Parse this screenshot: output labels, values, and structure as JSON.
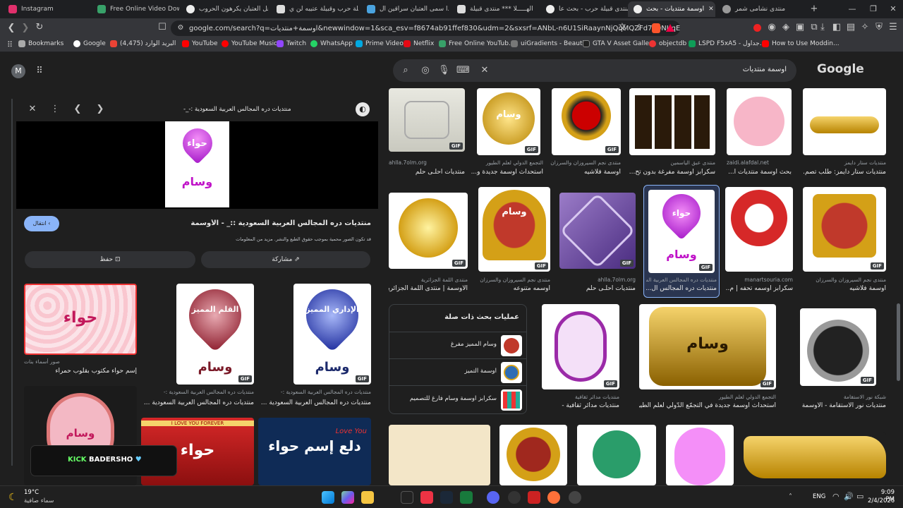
{
  "tabs": [
    {
      "title": "Instagram",
      "color": "#e1306c"
    },
    {
      "title": "Free Online Video Downlo",
      "color": "#38a169"
    },
    {
      "title": "هل العتبان يكرهون الحروب",
      "color": "#eee"
    },
    {
      "title": "قبيلة حرب وقبيلة عتيبه لن ي",
      "color": "#eee"
    },
    {
      "title": "لماذا سمى العتبان سراقين ال",
      "color": "#4aa3df"
    },
    {
      "title": "الهـــــلا *** منتدى قبيلة",
      "color": "#eee"
    },
    {
      "title": "منتدى قبيلة حرب - بحث عا",
      "color": "#eee"
    },
    {
      "title": "اوسمة منتديات - بحث",
      "color": "#eee",
      "active": true
    },
    {
      "title": "منتدى نشامى شمر",
      "color": "#eee"
    }
  ],
  "url": "google.com/search?q=اوسمة+منتديات&newwindow=1&sca_esv=f8674ab91ffef830&udm=2&sxsrf=ANbL-n6U1SiRaaynNjQqMQZFd7g0NJrqEQ...",
  "bookmarks": [
    "Bookmarks",
    "Google",
    "(4,475) البريد الوارد",
    "YouTube",
    "YouTube Music",
    "Twitch",
    "WhatsApp",
    "Prime Video",
    "Netflix",
    "Free Online YouTub...",
    "uiGradients - Beauti...",
    "GTA V Asset Gallery",
    "objectdb",
    "LSPD F5xA5 - جداول...",
    "How to Use Moddin..."
  ],
  "avatar": "M",
  "search": {
    "query": "اوسمة منتديات",
    "logo": "Google"
  },
  "preview": {
    "site": "منتديات دره المجالس العربية السعودية :-_-",
    "title": "منتديات دره المجالس العربية السعودية ::_ - الأوسمة",
    "notice": "قد تكون الصور محمية بموجب حقوق الطبع والنشر. مزيد من المعلومات",
    "visit": "انتقال",
    "save": "حفظ",
    "share": "مشاركة",
    "image_text": "حواء",
    "image_text2": "وسام"
  },
  "related_left": [
    {
      "cap": "إسم حواء مكتوب بقلوب حمراء",
      "src": "صور أسماء بنات",
      "word": "حواء"
    },
    {
      "cap": "منتديات دره المجالس العربية السعودية ...",
      "src": "منتديات دره المجالس العربية السعودية :-",
      "word": "القلم المميز"
    },
    {
      "cap": "منتديات دره المجالس العربية السعودية ...",
      "src": "منتديات دره المجالس العربية السعودية :-",
      "word": "الإداري المميز"
    }
  ],
  "related_bottom": [
    {
      "word": "وسام"
    },
    {
      "word": "حواء"
    },
    {
      "word": "دلع إسم حواء"
    }
  ],
  "results_row1": [
    {
      "cap": "منتديات احلـى حلم",
      "src": "ahlla.7olm.org"
    },
    {
      "cap": "استحداث أوسمة جديدة و...",
      "src": "التجمع الدولي لعلم الطيور"
    },
    {
      "cap": "اوسمة فلاشيه",
      "src": "منتدى نجم السيروزان والسرزان"
    },
    {
      "cap": "سكرابز أوسمة مفرغة بدون تح...",
      "src": "منتدى عبق الياسمين"
    },
    {
      "cap": "بحث أوسمة منتديات ا...",
      "src": "zaidi.alafdal.net"
    },
    {
      "cap": "منتديات ستار دايمز: طلب تصم...",
      "src": "منتديات ستار دايمز"
    }
  ],
  "results_row2": [
    {
      "cap": "الأوسمة | منتدى اللمة الجزائرية",
      "src": "منتدى اللمة الجزائرية"
    },
    {
      "cap": "اوسمه متنوعه",
      "src": "منتدى نجم السيروزان والسرزان"
    },
    {
      "cap": "منتديات احلـى حلم",
      "src": "ahlla.7olm.org"
    },
    {
      "cap": "منتديات دره المجالس ال...",
      "src": "منتديات دره المجالس العربية السعودية :-"
    },
    {
      "cap": "سكرابز اوسمه تحفه | م...",
      "src": "manartsouria.com"
    },
    {
      "cap": "اوسمة فلاشيه",
      "src": "منتدى نجم السيروزان والسرزان"
    }
  ],
  "related_searches": {
    "title": "عمليات بحث ذات صلة",
    "items": [
      "وسام المميز مفرغ",
      "اوسمة التميز",
      "سكرابز اوسمة وسام فارغ للتصميم"
    ]
  },
  "results_row3": [
    {
      "cap": "منتديات مدائر ثقافية -",
      "src": "منتديات مدائر ثقافية"
    },
    {
      "cap": "استحداث أوسمة جديدة في التجمّع الدّولي لعلم الطيور - 3...",
      "src": "التجمع الدولي لعلم الطيور"
    },
    {
      "cap": "منتديات نور الاستقامة - الأوسمة",
      "src": "شبكة نور الاستقامة"
    }
  ],
  "watermark": "BADERSHO",
  "taskbar": {
    "weather_temp": "19°C",
    "weather_desc": "سماء صافية",
    "lang": "ENG",
    "time": "9:09 PM",
    "date": "2/4/2026"
  }
}
